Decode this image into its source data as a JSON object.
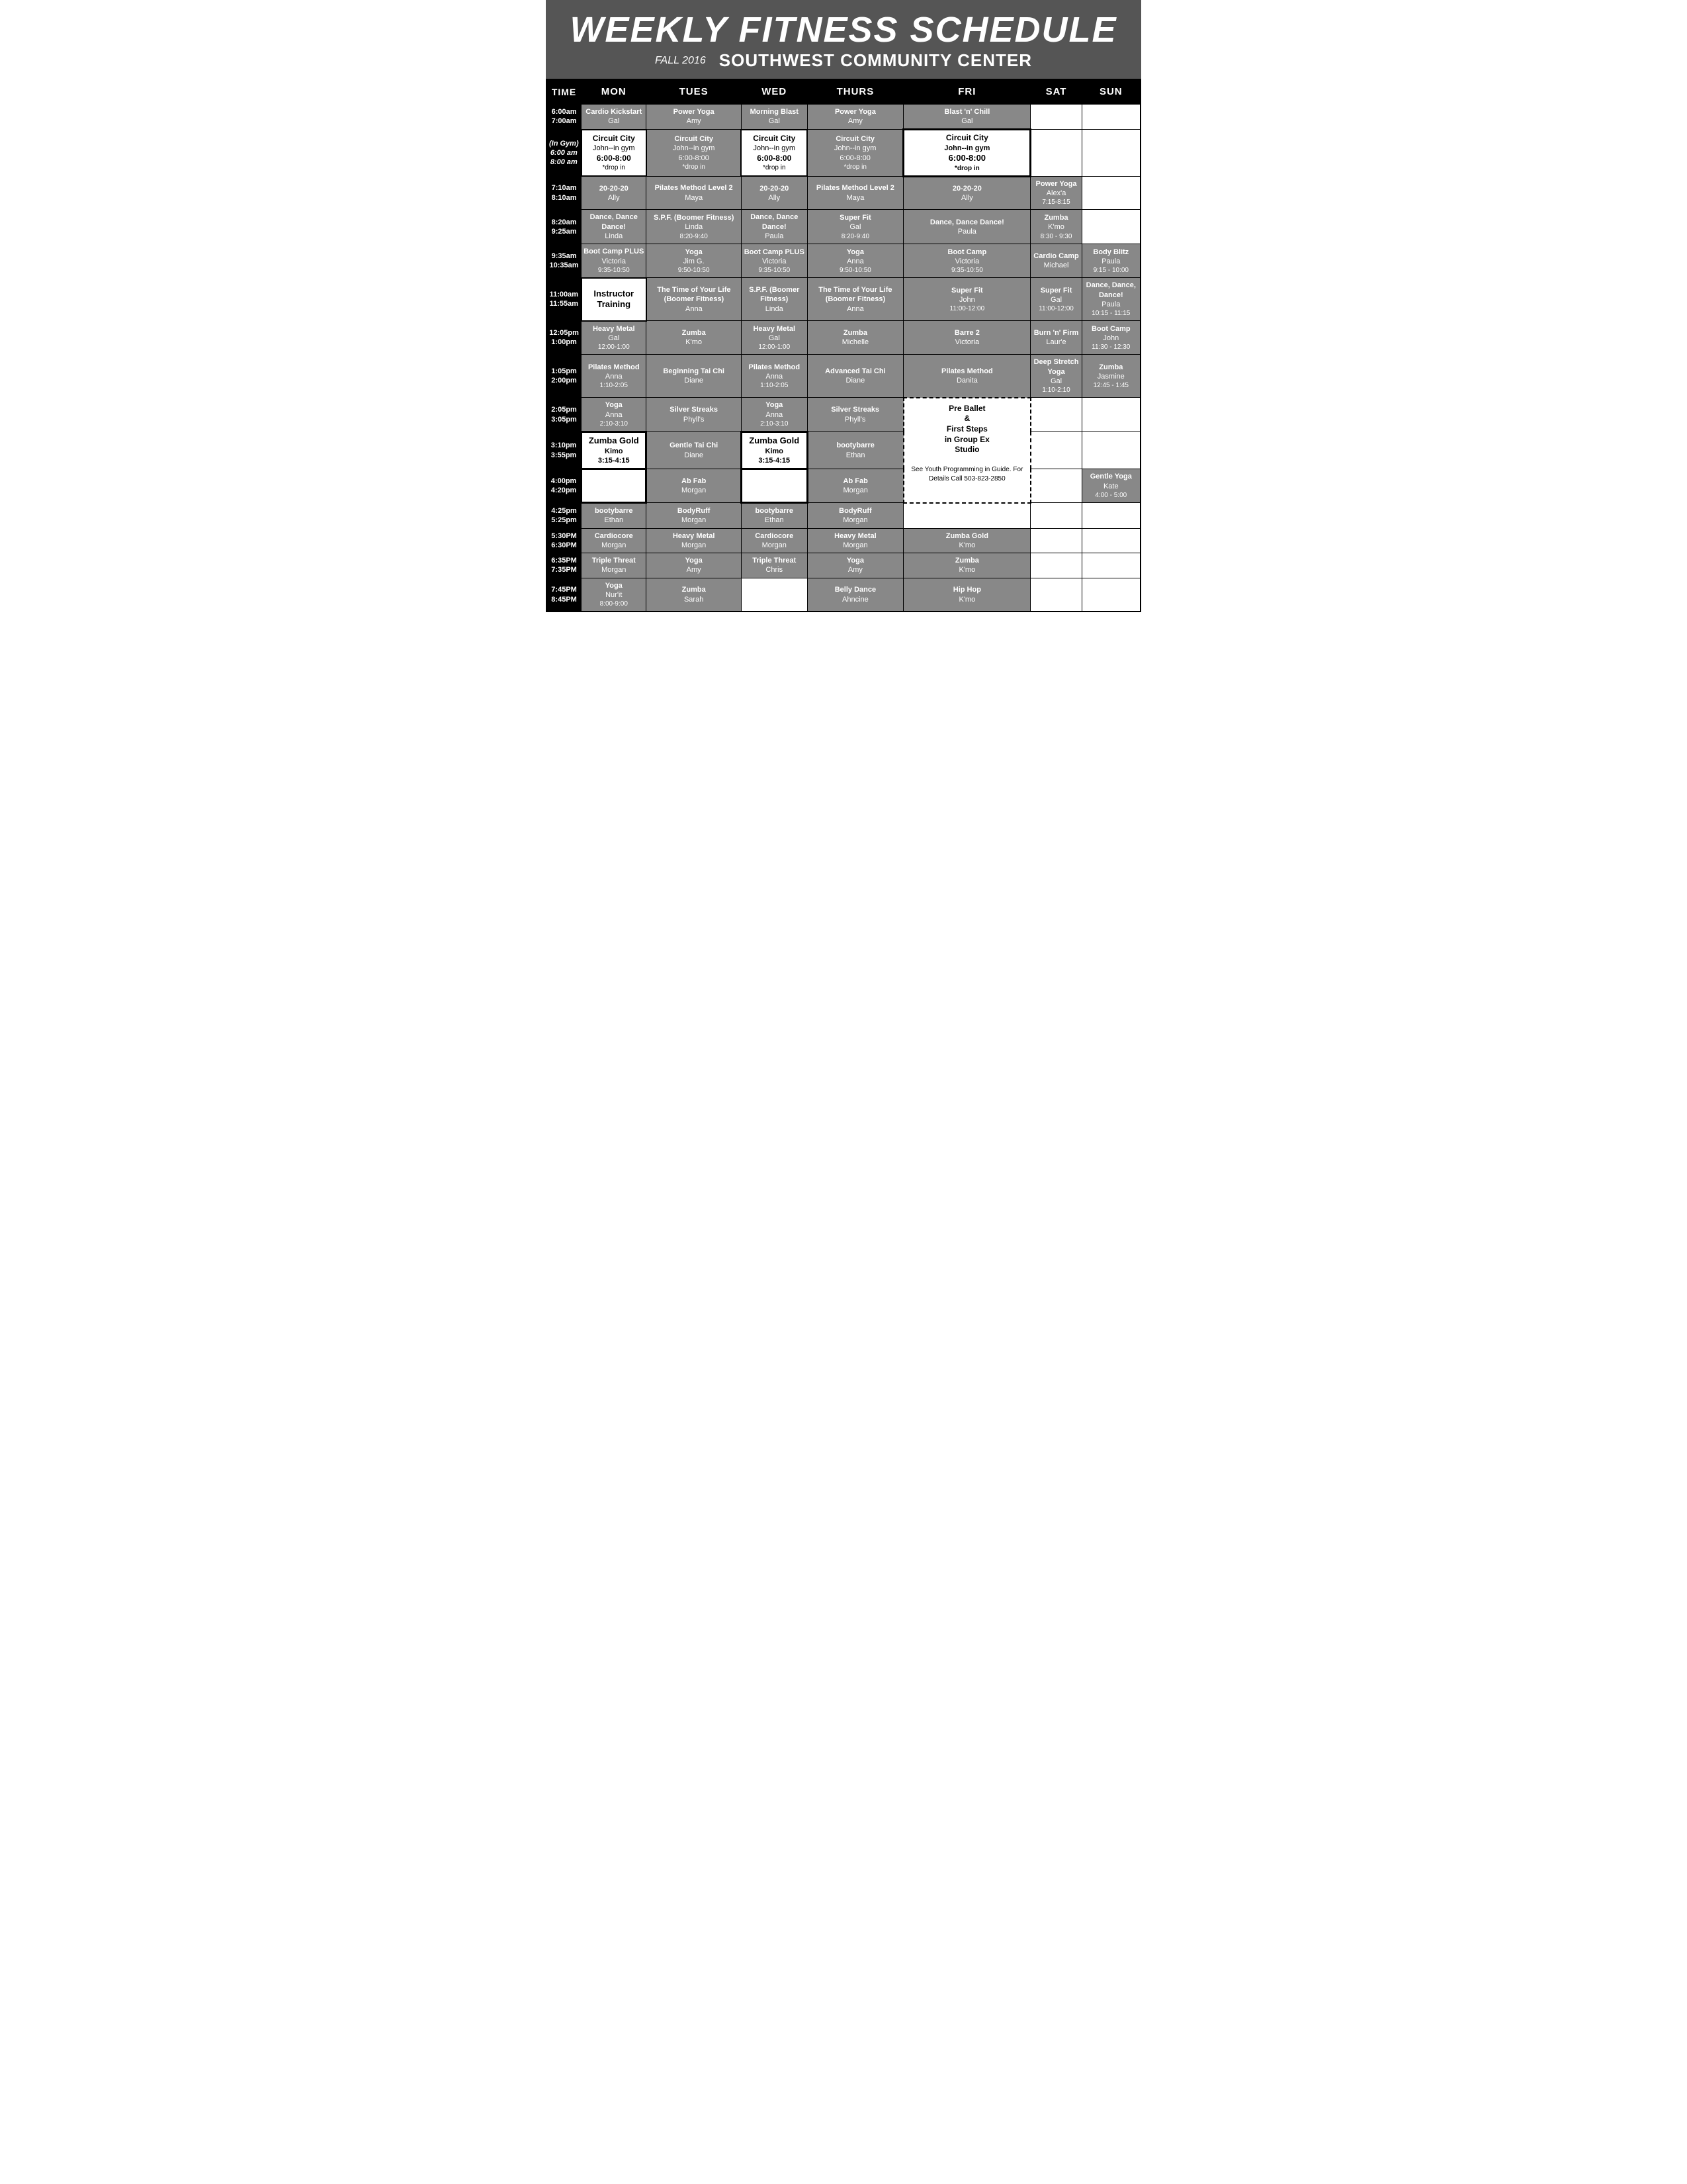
{
  "header": {
    "title": "WEEKLY FITNESS SCHEDULE",
    "season": "FALL 2016",
    "center": "SOUTHWEST COMMUNITY CENTER"
  },
  "columns": [
    "TIME",
    "MON",
    "TUES",
    "WED",
    "THURS",
    "FRI",
    "SAT",
    "SUN"
  ],
  "rows": [
    {
      "time": "6:00am\n7:00am",
      "mon": {
        "name": "Cardio Kickstart",
        "instructor": "Gal"
      },
      "tues": {
        "name": "Power Yoga",
        "instructor": "Amy"
      },
      "wed": {
        "name": "Morning Blast",
        "instructor": "Gal"
      },
      "thurs": {
        "name": "Power Yoga",
        "instructor": "Amy"
      },
      "fri": {
        "name": "Blast 'n' Chill",
        "instructor": "Gal"
      },
      "sat": {},
      "sun": {}
    },
    {
      "time": "(In Gym)\n6:00 am\n8:00 am",
      "mon": {
        "name": "Circuit City",
        "detail": "John--in gym",
        "time_detail": "6:00-8:00",
        "note": "*drop in",
        "style": "white"
      },
      "tues": {
        "name": "Circuit City",
        "detail": "John--in gym",
        "time_detail": "6:00-8:00",
        "note": "*drop in",
        "style": "gray"
      },
      "wed": {
        "name": "Circuit City",
        "detail": "John--in gym",
        "time_detail": "6:00-8:00",
        "note": "*drop in",
        "style": "white"
      },
      "thurs": {
        "name": "Circuit City",
        "detail": "John--in gym",
        "time_detail": "6:00-8:00",
        "note": "*drop in",
        "style": "gray"
      },
      "fri": {
        "name": "Circuit City",
        "detail": "John--in gym",
        "time_detail": "6:00-8:00",
        "note": "*drop in",
        "style": "white-bold"
      },
      "sat": {},
      "sun": {}
    },
    {
      "time": "7:10am\n8:10am",
      "mon": {
        "name": "20-20-20",
        "instructor": "Ally"
      },
      "tues": {
        "name": "Pilates Method Level 2",
        "instructor": "Maya"
      },
      "wed": {
        "name": "20-20-20",
        "instructor": "Ally"
      },
      "thurs": {
        "name": "Pilates Method Level 2",
        "instructor": "Maya"
      },
      "fri": {
        "name": "20-20-20",
        "instructor": "Ally"
      },
      "sat": {
        "name": "Power Yoga",
        "instructor": "Alex'a",
        "time_detail": "7:15-8:15"
      },
      "sun": {}
    },
    {
      "time": "8:20am\n9:25am",
      "mon": {
        "name": "Dance, Dance Dance!",
        "instructor": "Linda"
      },
      "tues": {
        "name": "S.P.F. (Boomer Fitness)",
        "instructor": "Linda",
        "time_detail": "8:20-9:40"
      },
      "wed": {
        "name": "Dance, Dance Dance!",
        "instructor": "Paula"
      },
      "thurs": {
        "name": "Super Fit",
        "instructor": "Gal",
        "time_detail": "8:20-9:40"
      },
      "fri": {
        "name": "Dance, Dance Dance!",
        "instructor": "Paula"
      },
      "sat": {
        "name": "Zumba",
        "instructor": "K'mo",
        "time_detail": "8:30 - 9:30"
      },
      "sun": {}
    },
    {
      "time": "9:35am\n10:35am",
      "mon": {
        "name": "Boot Camp PLUS",
        "instructor": "Victoria",
        "time_detail": "9:35-10:50"
      },
      "tues": {
        "name": "Yoga",
        "instructor": "Jim G.",
        "time_detail": "9:50-10:50"
      },
      "wed": {
        "name": "Boot Camp PLUS",
        "instructor": "Victoria",
        "time_detail": "9:35-10:50"
      },
      "thurs": {
        "name": "Yoga",
        "instructor": "Anna",
        "time_detail": "9:50-10:50"
      },
      "fri": {
        "name": "Boot Camp",
        "instructor": "Victoria",
        "time_detail": "9:35-10:50"
      },
      "sat": {
        "name": "Cardio Camp",
        "instructor": "Michael"
      },
      "sun": {
        "name": "Body Blitz",
        "instructor": "Paula",
        "time_detail": "9:15 - 10:00"
      }
    },
    {
      "time": "11:00am\n11:55am",
      "mon": {
        "name": "Instructor Training",
        "style": "white-plain"
      },
      "tues": {
        "name": "The Time of Your Life (Boomer Fitness)",
        "instructor": "Anna"
      },
      "wed": {
        "name": "S.P.F. (Boomer Fitness)",
        "instructor": "Linda"
      },
      "thurs": {
        "name": "The Time of Your Life (Boomer Fitness)",
        "instructor": "Anna"
      },
      "fri": {
        "name": "Super Fit",
        "instructor": "John",
        "time_detail": "11:00-12:00"
      },
      "sat": {
        "name": "Super Fit",
        "instructor": "Gal",
        "time_detail": "11:00-12:00"
      },
      "sun": {
        "name": "Dance, Dance, Dance!",
        "instructor": "Paula",
        "time_detail": "10:15 - 11:15"
      }
    },
    {
      "time": "12:05pm\n1:00pm",
      "mon": {
        "name": "Heavy Metal",
        "instructor": "Gal",
        "time_detail": "12:00-1:00"
      },
      "tues": {
        "name": "Zumba",
        "instructor": "K'mo"
      },
      "wed": {
        "name": "Heavy Metal",
        "instructor": "Gal",
        "time_detail": "12:00-1:00"
      },
      "thurs": {
        "name": "Zumba",
        "instructor": "Michelle"
      },
      "fri": {
        "name": "Barre 2",
        "instructor": "Victoria"
      },
      "sat": {
        "name": "Burn 'n' Firm",
        "instructor": "Laur'e"
      },
      "sun": {
        "name": "Boot Camp",
        "instructor": "John",
        "time_detail": "11:30 - 12:30"
      }
    },
    {
      "time": "1:05pm\n2:00pm",
      "mon": {
        "name": "Pilates Method",
        "instructor": "Anna",
        "time_detail": "1:10-2:05"
      },
      "tues": {
        "name": "Beginning Tai Chi",
        "instructor": "Diane"
      },
      "wed": {
        "name": "Pilates Method",
        "instructor": "Anna",
        "time_detail": "1:10-2:05"
      },
      "thurs": {
        "name": "Advanced Tai Chi",
        "instructor": "Diane"
      },
      "fri": {
        "name": "Pilates Method",
        "instructor": "Danita"
      },
      "sat": {
        "name": "Deep Stretch Yoga",
        "instructor": "Gal",
        "time_detail": "1:10-2:10"
      },
      "sun": {
        "name": "Zumba",
        "instructor": "Jasmine",
        "time_detail": "12:45 - 1:45"
      }
    },
    {
      "time": "2:05pm\n3:05pm",
      "mon": {
        "name": "Yoga",
        "instructor": "Anna",
        "time_detail": "2:10-3:10"
      },
      "tues": {
        "name": "Silver Streaks",
        "instructor": "Phyll's"
      },
      "wed": {
        "name": "Yoga",
        "instructor": "Anna",
        "time_detail": "2:10-3:10"
      },
      "thurs": {
        "name": "Silver Streaks",
        "instructor": "Phyll's"
      },
      "fri": {
        "name": "Pre Ballet & First Steps in Group Ex Studio",
        "style": "dashed",
        "note": "See Youth Programming in Guide. For Details Call 503-823-2850"
      },
      "sat": {},
      "sun": {}
    },
    {
      "time": "3:10pm\n3:55pm",
      "mon": {
        "name": "Zumba Gold",
        "instructor": "Kimo",
        "time_detail": "3:15-4:15",
        "style": "white-box"
      },
      "tues": {
        "name": "Gentle Tai Chi",
        "instructor": "Diane"
      },
      "wed": {
        "name": "Zumba Gold",
        "instructor": "Kimo",
        "time_detail": "3:15-4:15",
        "style": "white-box"
      },
      "thurs": {
        "name": "bootybarre",
        "instructor": "Ethan"
      },
      "fri": {
        "name": "",
        "style": "dashed-continue"
      },
      "sat": {},
      "sun": {}
    },
    {
      "time": "4:00pm\n4:20pm",
      "mon": {
        "name": "",
        "style": "white-box-bottom"
      },
      "tues": {
        "name": "Ab Fab",
        "instructor": "Morgan"
      },
      "wed": {
        "name": "",
        "style": "white-box-bottom"
      },
      "thurs": {
        "name": "Ab Fab",
        "instructor": "Morgan"
      },
      "fri": {
        "name": "",
        "style": "dashed-continue"
      },
      "sat": {},
      "sun": {
        "name": "Gentle Yoga",
        "instructor": "Kate",
        "time_detail": "4:00 - 5:00"
      }
    },
    {
      "time": "4:25pm\n5:25pm",
      "mon": {
        "name": "bootybarre",
        "instructor": "Ethan"
      },
      "tues": {
        "name": "BodyRuff",
        "instructor": "Morgan"
      },
      "wed": {
        "name": "bootybarre",
        "instructor": "Ethan"
      },
      "thurs": {
        "name": "BodyRuff",
        "instructor": "Morgan"
      },
      "fri": {},
      "sat": {},
      "sun": {}
    },
    {
      "time": "5:30PM\n6:30PM",
      "mon": {
        "name": "Cardiocore",
        "instructor": "Morgan"
      },
      "tues": {
        "name": "Heavy Metal",
        "instructor": "Morgan"
      },
      "wed": {
        "name": "Cardiocore",
        "instructor": "Morgan"
      },
      "thurs": {
        "name": "Heavy Metal",
        "instructor": "Morgan"
      },
      "fri": {
        "name": "Zumba Gold",
        "instructor": "K'mo"
      },
      "sat": {},
      "sun": {}
    },
    {
      "time": "6:35PM\n7:35PM",
      "mon": {
        "name": "Triple Threat",
        "instructor": "Morgan"
      },
      "tues": {
        "name": "Yoga",
        "instructor": "Amy"
      },
      "wed": {
        "name": "Triple Threat",
        "instructor": "Chris"
      },
      "thurs": {
        "name": "Yoga",
        "instructor": "Amy"
      },
      "fri": {
        "name": "Zumba",
        "instructor": "K'mo"
      },
      "sat": {},
      "sun": {}
    },
    {
      "time": "7:45PM\n8:45PM",
      "mon": {
        "name": "Yoga",
        "instructor": "Nur'it",
        "time_detail": "8:00-9:00"
      },
      "tues": {
        "name": "Zumba",
        "instructor": "Sarah"
      },
      "wed": {},
      "thurs": {
        "name": "Belly Dance",
        "instructor": "Ahncine"
      },
      "fri": {
        "name": "Hip Hop",
        "instructor": "K'mo"
      },
      "sat": {},
      "sun": {}
    }
  ]
}
